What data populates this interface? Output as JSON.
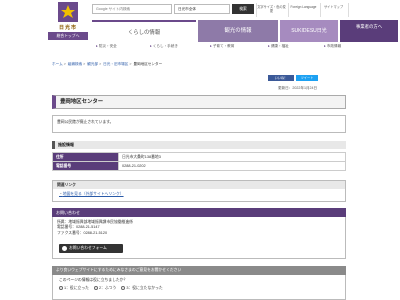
{
  "logo": {
    "city": "日光市",
    "sub": "総合トップへ"
  },
  "search": {
    "placeholder": "Google サイト内検索",
    "scope": "日光市全体",
    "button": "検索"
  },
  "utility": [
    {
      "label": "文字サイズ・色の変更"
    },
    {
      "label": "Foreign Language"
    },
    {
      "label": "サイトマップ"
    },
    {
      "label": ""
    }
  ],
  "nav": {
    "items": [
      {
        "label": "くらしの情報"
      },
      {
        "label": "観光の情報"
      },
      {
        "label": "SUKIDESU日光"
      },
      {
        "label": "事業者の方へ"
      }
    ],
    "sub": [
      {
        "label": "防災・安全"
      },
      {
        "label": "くらし・手続き"
      },
      {
        "label": "子育て・教育"
      },
      {
        "label": "健康・福祉"
      },
      {
        "label": "市政情報"
      }
    ]
  },
  "breadcrumb": {
    "items": [
      {
        "label": "ホーム"
      },
      {
        "label": "組織検索"
      },
      {
        "label": "観光部"
      },
      {
        "label": "日光・旧市場区"
      }
    ],
    "current": "豊岡地区センター"
  },
  "share": {
    "facebook": "いいね！",
    "twitter": "ツイート"
  },
  "updated": "更新日：2022年1月24日",
  "page": {
    "title": "豊岡地区センター",
    "notice": "豊岡公民館が廃止されています。"
  },
  "facility": {
    "heading": "施設情報",
    "rows": [
      {
        "label": "住所",
        "value": "日光市大桑町138番地3"
      },
      {
        "label": "電話番号",
        "value": "0288-21-0202"
      }
    ]
  },
  "links": {
    "heading": "関連リンク",
    "items": [
      {
        "label": "地図を見る（外部サイトへリンク）"
      }
    ]
  },
  "contact": {
    "heading": "お問い合わせ",
    "lines": [
      "所属：地域振興部地域振興課市民協働推進係",
      "電話番号：0288-21-5147",
      "ファクス番号：0288-21-5120"
    ],
    "button": "お問い合わせフォーム"
  },
  "survey": {
    "heading": "より良いウェブサイトにするためにみなさまのご意見をお聞かせください",
    "question": "このページの情報は役に立ちましたか？",
    "options": [
      {
        "label": "1：役に立った"
      },
      {
        "label": "2：ふつう"
      },
      {
        "label": "3：役に立たなかった"
      }
    ]
  },
  "colors": {
    "brand": "#5a3d7a",
    "link": "#2a5aa8"
  }
}
